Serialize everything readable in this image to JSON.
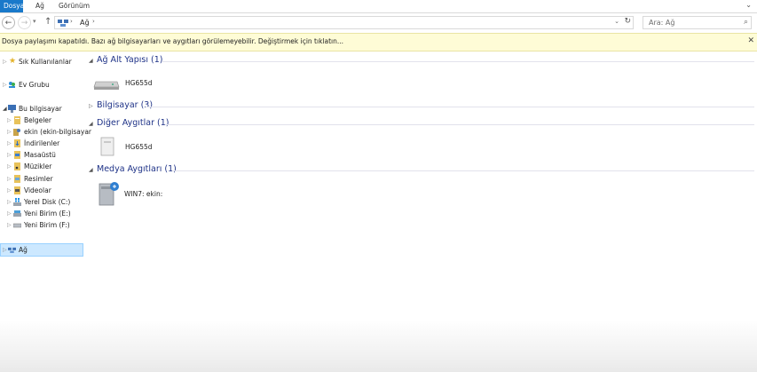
{
  "ribbon": {
    "tabs": [
      "Dosya",
      "Ağ",
      "Görünüm"
    ]
  },
  "address": {
    "path": [
      "Ağ"
    ],
    "search_placeholder": "Ara: Ağ"
  },
  "infobar": {
    "text": "Dosya paylaşımı kapatıldı. Bazı ağ bilgisayarları ve aygıtları görülemeyebilir. Değiştirmek için tıklatın..."
  },
  "navpane": {
    "quick_access": "Sık Kullanılanlar",
    "homegroup": "Ev Grubu",
    "this_pc": "Bu bilgisayar",
    "pc_items": [
      "Belgeler",
      "ekin (ekin-bilgisayar",
      "İndirilenler",
      "Masaüstü",
      "Müzikler",
      "Resimler",
      "Videolar",
      "Yerel Disk (C:)",
      "Yeni Birim (E:)",
      "Yeni Birim (F:)"
    ],
    "network": "Ağ"
  },
  "groups": [
    {
      "title": "Ağ Alt Yapısı (1)",
      "items": [
        "HG655d"
      ]
    },
    {
      "title": "Bilgisayar (3)",
      "items": []
    },
    {
      "title": "Diğer Aygıtlar (1)",
      "items": [
        "HG655d"
      ]
    },
    {
      "title": "Medya Aygıtları (1)",
      "items": [
        "WIN7: ekin:"
      ]
    }
  ],
  "colors": {
    "accent": "#1979ca",
    "group_title": "#1e3287",
    "selection": "#cce8ff",
    "infobar": "#fefcd6"
  }
}
